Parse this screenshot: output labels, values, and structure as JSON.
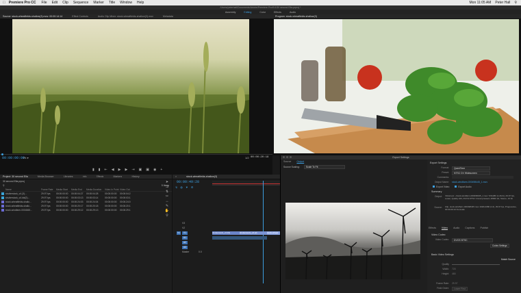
{
  "menubar": {
    "app": "Premiere Pro CC",
    "items": [
      "File",
      "Edit",
      "Clip",
      "Sequence",
      "Marker",
      "Title",
      "Window",
      "Help"
    ],
    "user": "Peter Hall",
    "clock": "Mon 11:05 AM"
  },
  "titlebar": "/Users/peterhall/Documents/Adobe/Premiere Pro/9.0/30 second Ella.prproj *",
  "workspaces": {
    "items": [
      "Assembly",
      "Editing",
      "Color",
      "Effects",
      "Audio"
    ],
    "active": "Editing"
  },
  "source_panel": {
    "tabs": [
      "Source: stock-wheatfields-shallow(3).mov: 00:00:14:14",
      "Effect Controls",
      "Audio Clip Mixer: stock-wheatfields-shallow(3).mov",
      "Metadata"
    ],
    "timecode_in": "00:00:00:00",
    "fit": "Fit",
    "quality": "1/2",
    "duration": "00:00:20:18"
  },
  "program_panel": {
    "tab": "Program: stock-wheatfields-shallow(3)"
  },
  "transport": {
    "controls": [
      "mark-in",
      "mark-out",
      "go-to-in",
      "step-back",
      "play",
      "step-forward",
      "go-to-out",
      "insert",
      "overwrite",
      "export-frame"
    ]
  },
  "project": {
    "tabs": [
      "Project: 30 second Ella",
      "Media Browser",
      "Libraries",
      "Info",
      "Effects",
      "Markers",
      "History"
    ],
    "file": "30 second Ella.prproj",
    "item_count": "5 Items",
    "columns": [
      "Name",
      "Frame Rate",
      "Media Start",
      "Media End",
      "Media Duration",
      "Video In Point",
      "Video Out"
    ],
    "rows": [
      {
        "name": "shutterstock_v4.(3)...",
        "rate": "29.97 fps",
        "start": "00:00:00:00",
        "end": "00:00:04:27",
        "dur": "00:00:04:28",
        "vin": "00:00:00:00",
        "vout": "00:00:04:2",
        "color": "#3aa5d8"
      },
      {
        "name": "shutterstock_v4.ldd(2)...",
        "rate": "29.97 fps",
        "start": "00:00:00:00",
        "end": "00:00:03:13",
        "dur": "00:00:03:14",
        "vin": "00:00:00:00",
        "vout": "00:00:03:1",
        "color": "#3aa5d8"
      },
      {
        "name": "stock-wheatfields-shallo...",
        "rate": "29.97 fps",
        "start": "00:00:00:00",
        "end": "00:00:24:03",
        "dur": "00:00:24:04",
        "vin": "00:00:00:00",
        "vout": "00:00:24:0",
        "color": "#6b6bd6"
      },
      {
        "name": "stock-wheatfields-shallo...",
        "rate": "29.97 fps",
        "start": "00:00:00:00",
        "end": "00:00:20:17",
        "dur": "00:00:20:18",
        "vin": "00:00:00:00",
        "vout": "00:00:20:1",
        "color": "#6b6bd6"
      },
      {
        "name": "stock-windfarm-0004845...",
        "rate": "29.97 fps",
        "start": "00:00:00:00",
        "end": "00:00:29:12",
        "dur": "00:00:29:13",
        "vin": "00:00:00:00",
        "vout": "00:00:29:1",
        "color": "#6b6bd6"
      }
    ]
  },
  "timeline": {
    "tab": "stock-wheatfields-shallow(3)",
    "timecode": "00:00:49:28",
    "tracks": [
      "V3",
      "V2",
      "V1",
      "A1",
      "A2",
      "A3",
      "Master"
    ],
    "master_value": "0.0",
    "clips": [
      {
        "label": "shutterstock_v4.l(3)",
        "track": "V1"
      },
      {
        "label": "shutterstock_v4.(2)",
        "track": "V1"
      },
      {
        "label": "stock-wheat",
        "track": "V1"
      }
    ]
  },
  "export": {
    "title": "Export Settings",
    "tabs": [
      "Source",
      "Output"
    ],
    "active_tab": "Output",
    "source_scaling_label": "Source Scaling:",
    "source_scaling": "Scale To Fit",
    "section_export": "Export Settings",
    "format_label": "Format:",
    "format": "QuickTime",
    "preset_label": "Preset:",
    "preset": "NTSC DV Widescreen",
    "comments_label": "Comments:",
    "output_name_label": "Output Name:",
    "output_name": "stock-windfarm-000498445_1.mov",
    "export_video": "Export Video",
    "export_audio": "Export Audio",
    "summary": "Summary",
    "summary_output_label": "Output:",
    "summary_output": "/Volumes/.../stock-windfarm-000498445_1.mov 720x480 (1.2121), 29.97 fps, Lower, Quality 100, DVCS NTSC Uncompressed, 48000 Hz, Stereo, 16 bit",
    "summary_source_label": "Source:",
    "summary_source": "Clip, stock-windfarm-000498445.mov 1920x1080 (1.0), 29.97 fps, Progressive, 00:00:29:13 No Audio",
    "settings_tabs": [
      "Effects",
      "Video",
      "Audio",
      "Captions",
      "Publish"
    ],
    "active_settings_tab": "Video",
    "video_codec_section": "Video Codec",
    "video_codec_label": "Video Codec:",
    "video_codec": "DVCS NTSC",
    "codec_settings": "Codec Settings",
    "basic_video_section": "Basic Video Settings",
    "match_source": "Match Source",
    "quality_label": "Quality",
    "width_label": "Width:",
    "width": "720",
    "height_label": "Height:",
    "height": "480",
    "frame_rate_label": "Frame Rate:",
    "frame_rate": "29.97",
    "field_order_label": "Field Order:",
    "field_order": "Lower First"
  },
  "colors": {
    "accent": "#3d9fe0",
    "clip_blue": "#6b84c8",
    "playhead": "#3d9fe0"
  }
}
